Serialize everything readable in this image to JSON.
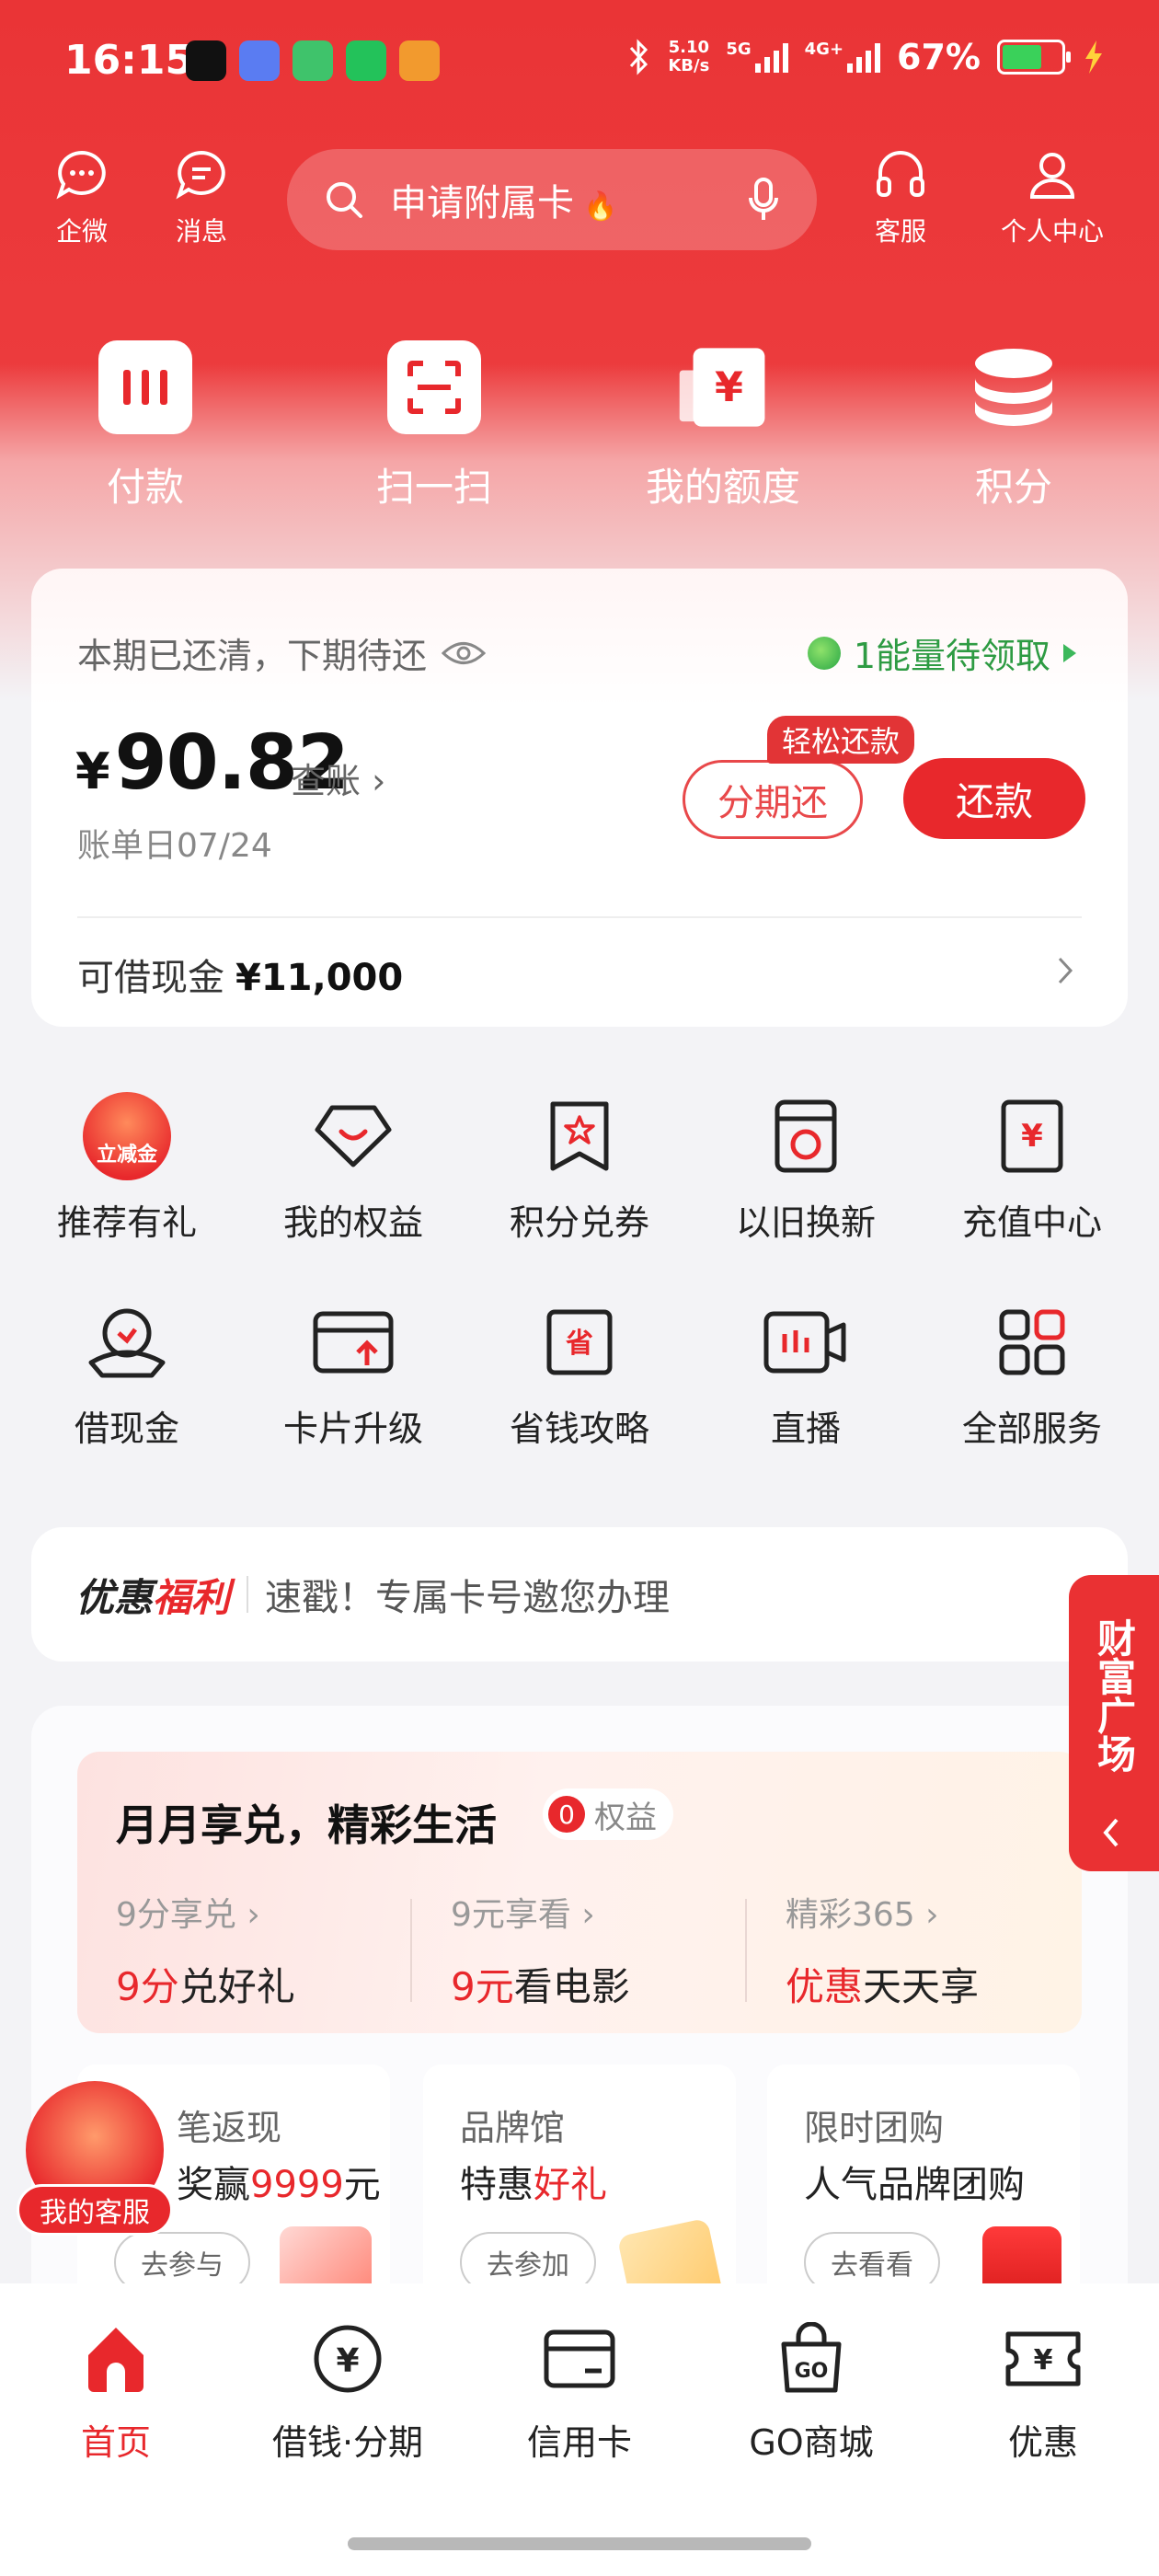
{
  "status": {
    "time": "16:15",
    "speed_value": "5.10",
    "speed_unit": "KB/s",
    "net1": "5G",
    "net2": "4G+",
    "battery": "67%"
  },
  "topnav": {
    "wecom": "企微",
    "messages": "消息",
    "search_placeholder": "申请附属卡",
    "support": "客服",
    "profile": "个人中心"
  },
  "quick_actions": [
    "付款",
    "扫一扫",
    "我的额度",
    "积分"
  ],
  "bill": {
    "state": "本期已还清，下期待还",
    "energy": "1能量待领取",
    "currency": "¥",
    "amount": "90.82",
    "check": "查账",
    "date": "账单日07/24",
    "installment": "分期还",
    "easy_badge": "轻松还款",
    "repay": "还款",
    "cash_label": "可借现金",
    "cash_value": "¥11,000"
  },
  "services": [
    {
      "label": "推荐有礼",
      "icon": "gift-coin-icon",
      "tag": "立减金"
    },
    {
      "label": "我的权益",
      "icon": "heart-diamond-icon"
    },
    {
      "label": "积分兑券",
      "icon": "bookmark-star-icon"
    },
    {
      "label": "以旧换新",
      "icon": "washer-icon"
    },
    {
      "label": "充值中心",
      "icon": "yuan-card-icon"
    },
    {
      "label": "借现金",
      "icon": "hand-coin-icon"
    },
    {
      "label": "卡片升级",
      "icon": "card-upgrade-icon"
    },
    {
      "label": "省钱攻略",
      "icon": "save-money-icon"
    },
    {
      "label": "直播",
      "icon": "live-icon"
    },
    {
      "label": "全部服务",
      "icon": "grid-icon"
    }
  ],
  "promo": {
    "brand1": "优惠",
    "brand2": "福利",
    "text": "速戳！专属卡号邀您办理"
  },
  "sidetab": "财富广场",
  "monthly": {
    "title": "月月享兑，精彩生活",
    "badge_count": "0",
    "badge_label": "权益",
    "cols": [
      {
        "sub": "9分享兑",
        "hl": "9分",
        "rest": "兑好礼"
      },
      {
        "sub": "9元享看",
        "hl": "9元",
        "rest": "看电影"
      },
      {
        "sub": "精彩365",
        "hl": "优惠",
        "rest": "天天享"
      }
    ]
  },
  "minis": [
    {
      "t1": "笔返现",
      "t2a": "奖赢",
      "t2b": "9999",
      "t2c": "元",
      "go": "去参与"
    },
    {
      "t1": "品牌馆",
      "t2a": "特惠",
      "t2b": "好礼",
      "t2c": "",
      "go": "去参加"
    },
    {
      "t1": "限时团购",
      "t2a": "人气品牌团购",
      "t2b": "",
      "t2c": "",
      "go": "去看看"
    }
  ],
  "float_cs": "我的客服",
  "bottomnav": [
    "首页",
    "借钱·分期",
    "信用卡",
    "GO商城",
    "优惠"
  ],
  "colors": {
    "brand_red": "#e8282c",
    "green": "#2e9b43"
  }
}
